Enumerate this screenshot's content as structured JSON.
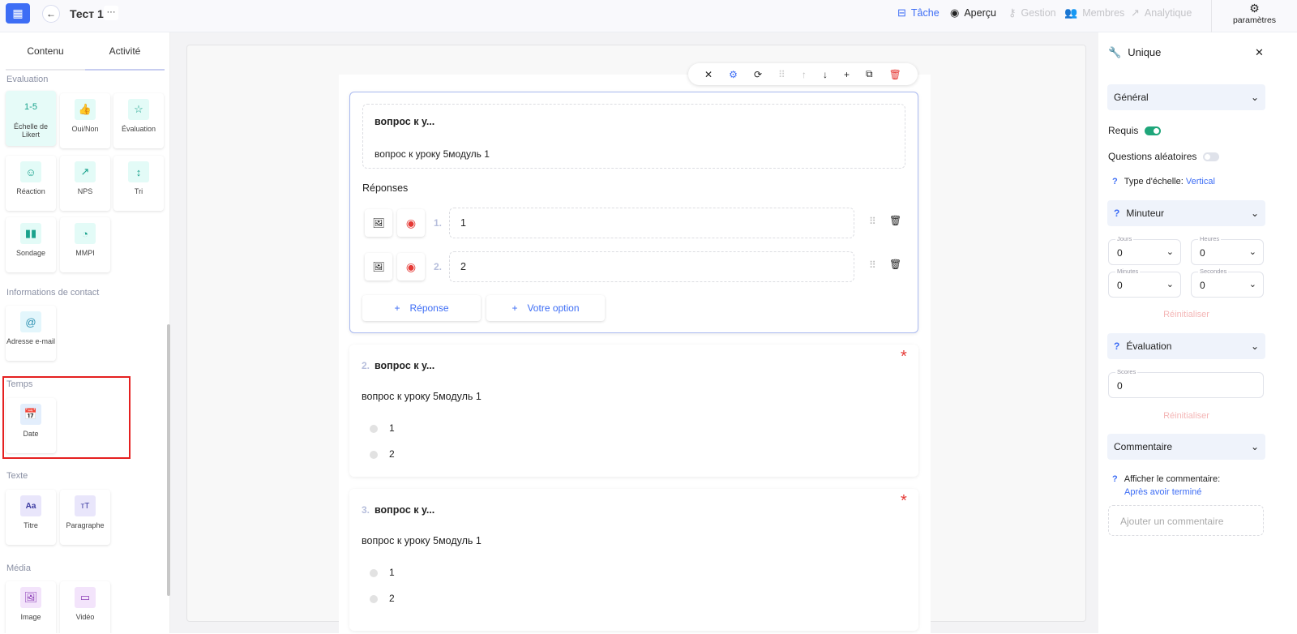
{
  "topbar": {
    "title": "Тест 1",
    "more": "···",
    "nav": [
      {
        "label": "Tâche",
        "icon": "briefcase-icon"
      },
      {
        "label": "Aperçu",
        "icon": "eye-icon"
      },
      {
        "label": "Gestion",
        "icon": "key-icon"
      },
      {
        "label": "Membres",
        "icon": "users-icon"
      },
      {
        "label": "Analytique",
        "icon": "trend-icon"
      }
    ],
    "settings": "paramètres"
  },
  "sidebar": {
    "tabs": [
      "Contenu",
      "Activité"
    ],
    "sections": [
      {
        "title": "Evaluation",
        "items": [
          {
            "label": "Échelle de Likert",
            "icon": "1-5"
          },
          {
            "label": "Oui/Non",
            "icon": "thumbs-icon"
          },
          {
            "label": "Évaluation",
            "icon": "star-icon"
          },
          {
            "label": "Réaction",
            "icon": "smiley-icon"
          },
          {
            "label": "NPS",
            "icon": "trend-icon"
          },
          {
            "label": "Tri",
            "icon": "sort-icon"
          },
          {
            "label": "Sondage",
            "icon": "bars-icon"
          },
          {
            "label": "MMPI",
            "icon": "pie-icon"
          }
        ]
      },
      {
        "title": "Informations de contact",
        "items": [
          {
            "label": "Adresse e-mail",
            "icon": "at-icon"
          }
        ]
      },
      {
        "title": "Temps",
        "items": [
          {
            "label": "Date",
            "icon": "calendar-icon"
          }
        ]
      },
      {
        "title": "Texte",
        "items": [
          {
            "label": "Titre",
            "icon": "Aa"
          },
          {
            "label": "Paragraphe",
            "icon": "тT"
          }
        ]
      },
      {
        "title": "Média",
        "items": [
          {
            "label": "Image",
            "icon": "image-icon"
          },
          {
            "label": "Vidéo",
            "icon": "video-icon"
          }
        ]
      }
    ]
  },
  "editor": {
    "q1": {
      "title": "вопрос к у...",
      "text": "вопрос к уроку 5модуль 1",
      "answers_label": "Réponses",
      "answers": [
        {
          "num": "1.",
          "value": "1"
        },
        {
          "num": "2.",
          "value": "2"
        }
      ],
      "add_answer": "Réponse",
      "add_option": "Votre option"
    },
    "q2": {
      "num": "2.",
      "title": "вопрос к у...",
      "text": "вопрос к уроку 5модуль 1",
      "options": [
        "1",
        "2"
      ]
    },
    "q3": {
      "num": "3.",
      "title": "вопрос к у...",
      "text": "вопрос к уроку 5модуль 1",
      "options": [
        "1",
        "2"
      ]
    }
  },
  "panel": {
    "title": "Unique",
    "general": "Général",
    "required": "Requis",
    "required_on": true,
    "random": "Questions aléatoires",
    "random_on": false,
    "scale_type_label": "Type d'échelle:",
    "scale_type": "Vertical",
    "timer": "Minuteur",
    "jours_label": "Jours",
    "jours": "0",
    "heures_label": "Heures",
    "heures": "0",
    "minutes_label": "Minutes",
    "minutes": "0",
    "secondes_label": "Secondes",
    "secondes": "0",
    "reset": "Réinitialiser",
    "evaluation": "Évaluation",
    "scores_label": "Scores",
    "scores": "0",
    "reset2": "Réinitialiser",
    "comment": "Commentaire",
    "show_comment": "Afficher le commentaire:",
    "show_comment_value": "Après avoir terminé",
    "add_comment": "Ajouter un commentaire"
  },
  "colors": {
    "accent": "#3d6df5",
    "danger": "#e53935",
    "toggle_on": "#1fa67a"
  }
}
